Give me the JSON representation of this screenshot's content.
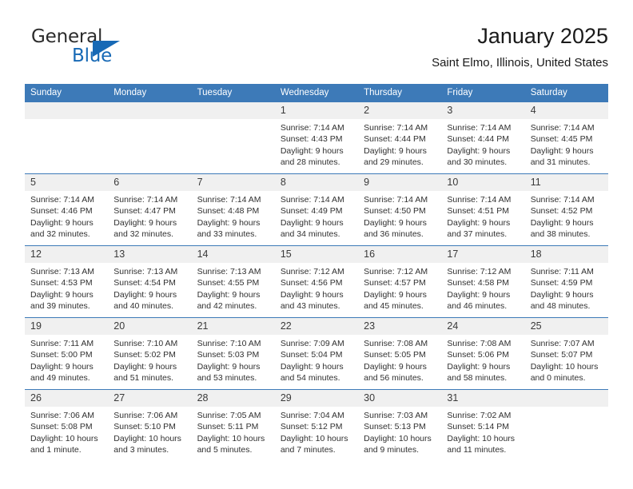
{
  "brand": {
    "name_part1": "General",
    "name_part2": "Blue",
    "logo_icon": "triangle-flag-icon",
    "accent_color": "#1769b5"
  },
  "header": {
    "title": "January 2025",
    "subtitle": "Saint Elmo, Illinois, United States"
  },
  "calendar": {
    "header_color": "#3d7ab8",
    "daynum_band_color": "#f0f0f0",
    "weekday_headers": [
      "Sunday",
      "Monday",
      "Tuesday",
      "Wednesday",
      "Thursday",
      "Friday",
      "Saturday"
    ],
    "weeks": [
      [
        {
          "day": "",
          "empty": true
        },
        {
          "day": "",
          "empty": true
        },
        {
          "day": "",
          "empty": true
        },
        {
          "day": "1",
          "sunrise": "Sunrise: 7:14 AM",
          "sunset": "Sunset: 4:43 PM",
          "daylight_line1": "Daylight: 9 hours",
          "daylight_line2": "and 28 minutes."
        },
        {
          "day": "2",
          "sunrise": "Sunrise: 7:14 AM",
          "sunset": "Sunset: 4:44 PM",
          "daylight_line1": "Daylight: 9 hours",
          "daylight_line2": "and 29 minutes."
        },
        {
          "day": "3",
          "sunrise": "Sunrise: 7:14 AM",
          "sunset": "Sunset: 4:44 PM",
          "daylight_line1": "Daylight: 9 hours",
          "daylight_line2": "and 30 minutes."
        },
        {
          "day": "4",
          "sunrise": "Sunrise: 7:14 AM",
          "sunset": "Sunset: 4:45 PM",
          "daylight_line1": "Daylight: 9 hours",
          "daylight_line2": "and 31 minutes."
        }
      ],
      [
        {
          "day": "5",
          "sunrise": "Sunrise: 7:14 AM",
          "sunset": "Sunset: 4:46 PM",
          "daylight_line1": "Daylight: 9 hours",
          "daylight_line2": "and 32 minutes."
        },
        {
          "day": "6",
          "sunrise": "Sunrise: 7:14 AM",
          "sunset": "Sunset: 4:47 PM",
          "daylight_line1": "Daylight: 9 hours",
          "daylight_line2": "and 32 minutes."
        },
        {
          "day": "7",
          "sunrise": "Sunrise: 7:14 AM",
          "sunset": "Sunset: 4:48 PM",
          "daylight_line1": "Daylight: 9 hours",
          "daylight_line2": "and 33 minutes."
        },
        {
          "day": "8",
          "sunrise": "Sunrise: 7:14 AM",
          "sunset": "Sunset: 4:49 PM",
          "daylight_line1": "Daylight: 9 hours",
          "daylight_line2": "and 34 minutes."
        },
        {
          "day": "9",
          "sunrise": "Sunrise: 7:14 AM",
          "sunset": "Sunset: 4:50 PM",
          "daylight_line1": "Daylight: 9 hours",
          "daylight_line2": "and 36 minutes."
        },
        {
          "day": "10",
          "sunrise": "Sunrise: 7:14 AM",
          "sunset": "Sunset: 4:51 PM",
          "daylight_line1": "Daylight: 9 hours",
          "daylight_line2": "and 37 minutes."
        },
        {
          "day": "11",
          "sunrise": "Sunrise: 7:14 AM",
          "sunset": "Sunset: 4:52 PM",
          "daylight_line1": "Daylight: 9 hours",
          "daylight_line2": "and 38 minutes."
        }
      ],
      [
        {
          "day": "12",
          "sunrise": "Sunrise: 7:13 AM",
          "sunset": "Sunset: 4:53 PM",
          "daylight_line1": "Daylight: 9 hours",
          "daylight_line2": "and 39 minutes."
        },
        {
          "day": "13",
          "sunrise": "Sunrise: 7:13 AM",
          "sunset": "Sunset: 4:54 PM",
          "daylight_line1": "Daylight: 9 hours",
          "daylight_line2": "and 40 minutes."
        },
        {
          "day": "14",
          "sunrise": "Sunrise: 7:13 AM",
          "sunset": "Sunset: 4:55 PM",
          "daylight_line1": "Daylight: 9 hours",
          "daylight_line2": "and 42 minutes."
        },
        {
          "day": "15",
          "sunrise": "Sunrise: 7:12 AM",
          "sunset": "Sunset: 4:56 PM",
          "daylight_line1": "Daylight: 9 hours",
          "daylight_line2": "and 43 minutes."
        },
        {
          "day": "16",
          "sunrise": "Sunrise: 7:12 AM",
          "sunset": "Sunset: 4:57 PM",
          "daylight_line1": "Daylight: 9 hours",
          "daylight_line2": "and 45 minutes."
        },
        {
          "day": "17",
          "sunrise": "Sunrise: 7:12 AM",
          "sunset": "Sunset: 4:58 PM",
          "daylight_line1": "Daylight: 9 hours",
          "daylight_line2": "and 46 minutes."
        },
        {
          "day": "18",
          "sunrise": "Sunrise: 7:11 AM",
          "sunset": "Sunset: 4:59 PM",
          "daylight_line1": "Daylight: 9 hours",
          "daylight_line2": "and 48 minutes."
        }
      ],
      [
        {
          "day": "19",
          "sunrise": "Sunrise: 7:11 AM",
          "sunset": "Sunset: 5:00 PM",
          "daylight_line1": "Daylight: 9 hours",
          "daylight_line2": "and 49 minutes."
        },
        {
          "day": "20",
          "sunrise": "Sunrise: 7:10 AM",
          "sunset": "Sunset: 5:02 PM",
          "daylight_line1": "Daylight: 9 hours",
          "daylight_line2": "and 51 minutes."
        },
        {
          "day": "21",
          "sunrise": "Sunrise: 7:10 AM",
          "sunset": "Sunset: 5:03 PM",
          "daylight_line1": "Daylight: 9 hours",
          "daylight_line2": "and 53 minutes."
        },
        {
          "day": "22",
          "sunrise": "Sunrise: 7:09 AM",
          "sunset": "Sunset: 5:04 PM",
          "daylight_line1": "Daylight: 9 hours",
          "daylight_line2": "and 54 minutes."
        },
        {
          "day": "23",
          "sunrise": "Sunrise: 7:08 AM",
          "sunset": "Sunset: 5:05 PM",
          "daylight_line1": "Daylight: 9 hours",
          "daylight_line2": "and 56 minutes."
        },
        {
          "day": "24",
          "sunrise": "Sunrise: 7:08 AM",
          "sunset": "Sunset: 5:06 PM",
          "daylight_line1": "Daylight: 9 hours",
          "daylight_line2": "and 58 minutes."
        },
        {
          "day": "25",
          "sunrise": "Sunrise: 7:07 AM",
          "sunset": "Sunset: 5:07 PM",
          "daylight_line1": "Daylight: 10 hours",
          "daylight_line2": "and 0 minutes."
        }
      ],
      [
        {
          "day": "26",
          "sunrise": "Sunrise: 7:06 AM",
          "sunset": "Sunset: 5:08 PM",
          "daylight_line1": "Daylight: 10 hours",
          "daylight_line2": "and 1 minute."
        },
        {
          "day": "27",
          "sunrise": "Sunrise: 7:06 AM",
          "sunset": "Sunset: 5:10 PM",
          "daylight_line1": "Daylight: 10 hours",
          "daylight_line2": "and 3 minutes."
        },
        {
          "day": "28",
          "sunrise": "Sunrise: 7:05 AM",
          "sunset": "Sunset: 5:11 PM",
          "daylight_line1": "Daylight: 10 hours",
          "daylight_line2": "and 5 minutes."
        },
        {
          "day": "29",
          "sunrise": "Sunrise: 7:04 AM",
          "sunset": "Sunset: 5:12 PM",
          "daylight_line1": "Daylight: 10 hours",
          "daylight_line2": "and 7 minutes."
        },
        {
          "day": "30",
          "sunrise": "Sunrise: 7:03 AM",
          "sunset": "Sunset: 5:13 PM",
          "daylight_line1": "Daylight: 10 hours",
          "daylight_line2": "and 9 minutes."
        },
        {
          "day": "31",
          "sunrise": "Sunrise: 7:02 AM",
          "sunset": "Sunset: 5:14 PM",
          "daylight_line1": "Daylight: 10 hours",
          "daylight_line2": "and 11 minutes."
        },
        {
          "day": "",
          "empty": true
        }
      ]
    ]
  }
}
